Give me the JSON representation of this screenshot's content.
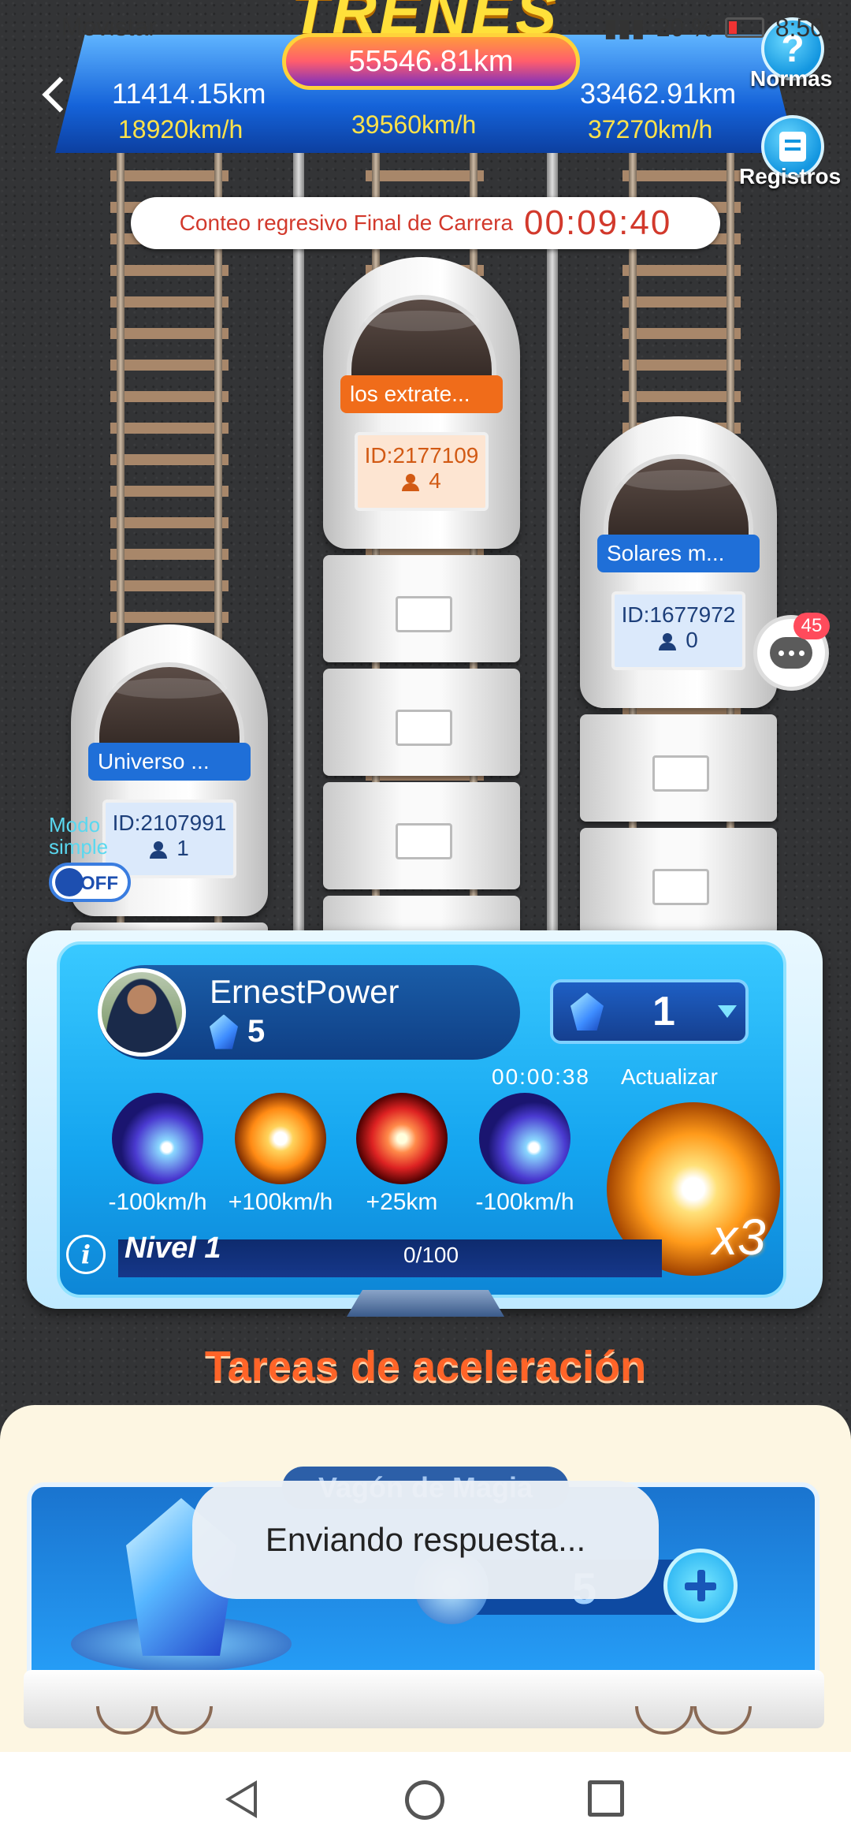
{
  "status_bar": {
    "carrier": "Movistar",
    "battery": "20 %",
    "time": "8:50"
  },
  "header": {
    "title": "TRENES FAMILIAR",
    "total_distance": "55546.81km",
    "left_distance": "11414.15km",
    "left_speed": "18920km/h",
    "center_speed": "39560km/h",
    "right_distance": "33462.91km",
    "right_speed": "37270km/h"
  },
  "buttons": {
    "rules_label": "Normas",
    "records_label": "Registros",
    "rules_icon": "?"
  },
  "countdown": {
    "label": "Conteo regresivo Final de Carrera",
    "time": "00:09:40"
  },
  "trains": [
    {
      "name": "Universo ...",
      "id": "ID:2107991",
      "members": "1",
      "color": "#1f6fd8"
    },
    {
      "name": "los extrate...",
      "id": "ID:2177109",
      "members": "4",
      "color": "#f06c1a"
    },
    {
      "name": "Solares m...",
      "id": "ID:1677972",
      "members": "0",
      "color": "#1f6fd8"
    }
  ],
  "chat": {
    "badge": "45"
  },
  "simple_mode": {
    "label": "Modo simple",
    "toggle": "OFF"
  },
  "panel": {
    "username": "ErnestPower",
    "gems": "5",
    "selected_qty": "1",
    "timer": "00:00:38",
    "update_label": "Actualizar",
    "skills": [
      {
        "label": "-100km/h",
        "icon": "blue-comet-skill"
      },
      {
        "label": "+100km/h",
        "icon": "orange-burst-skill"
      },
      {
        "label": "+25km",
        "icon": "red-spring-skill"
      },
      {
        "label": "-100km/h",
        "icon": "blue-comet-skill"
      }
    ],
    "multiplier": "x3",
    "level": "Nivel 1",
    "progress": "0/100",
    "progress_fraction": 0
  },
  "tasks": {
    "title": "Tareas de aceleración",
    "card_title": "Vagón de Magia",
    "quantity": "5"
  },
  "toast": "Enviando respuesta..."
}
